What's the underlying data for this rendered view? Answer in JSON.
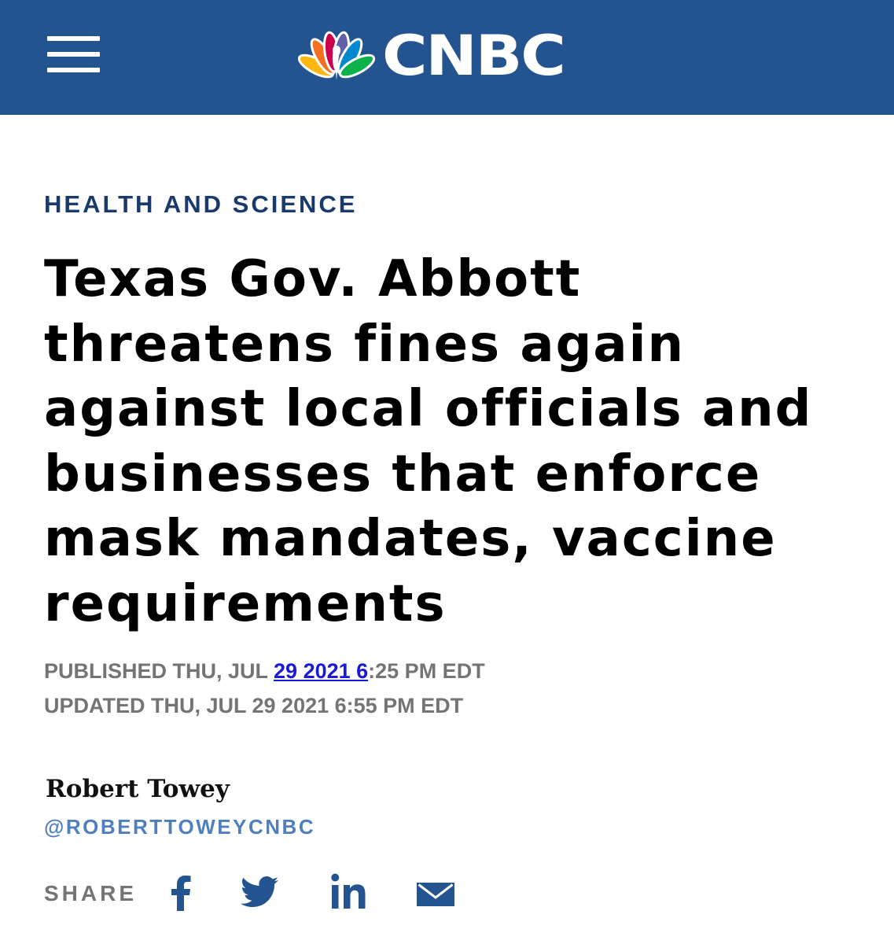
{
  "header": {
    "menu_icon": "hamburger-menu-icon",
    "logo_icon": "nbc-peacock-icon",
    "logo_text": "CNBC",
    "background_color": "#23548f"
  },
  "article": {
    "category": "HEALTH AND SCIENCE",
    "headline": "Texas Gov. Abbott threatens fines again against local officials and businesses that enforce mask mandates, vaccine requirements",
    "published": {
      "prefix": "PUBLISHED THU, JUL ",
      "link_text": "29 2021 6",
      "suffix": ":25 PM EDT"
    },
    "updated": "UPDATED THU, JUL 29 2021 6:55 PM EDT",
    "author": "Robert Towey",
    "author_handle": "@ROBERTTOWEYCNBC"
  },
  "share": {
    "label": "SHARE",
    "icons": [
      "facebook-icon",
      "twitter-icon",
      "linkedin-icon",
      "email-icon"
    ],
    "icon_color": "#23548f"
  },
  "colors": {
    "category": "#1a3a6b",
    "meta": "#747474",
    "link": "#1a1ad6",
    "handle": "#4f7fbf"
  }
}
